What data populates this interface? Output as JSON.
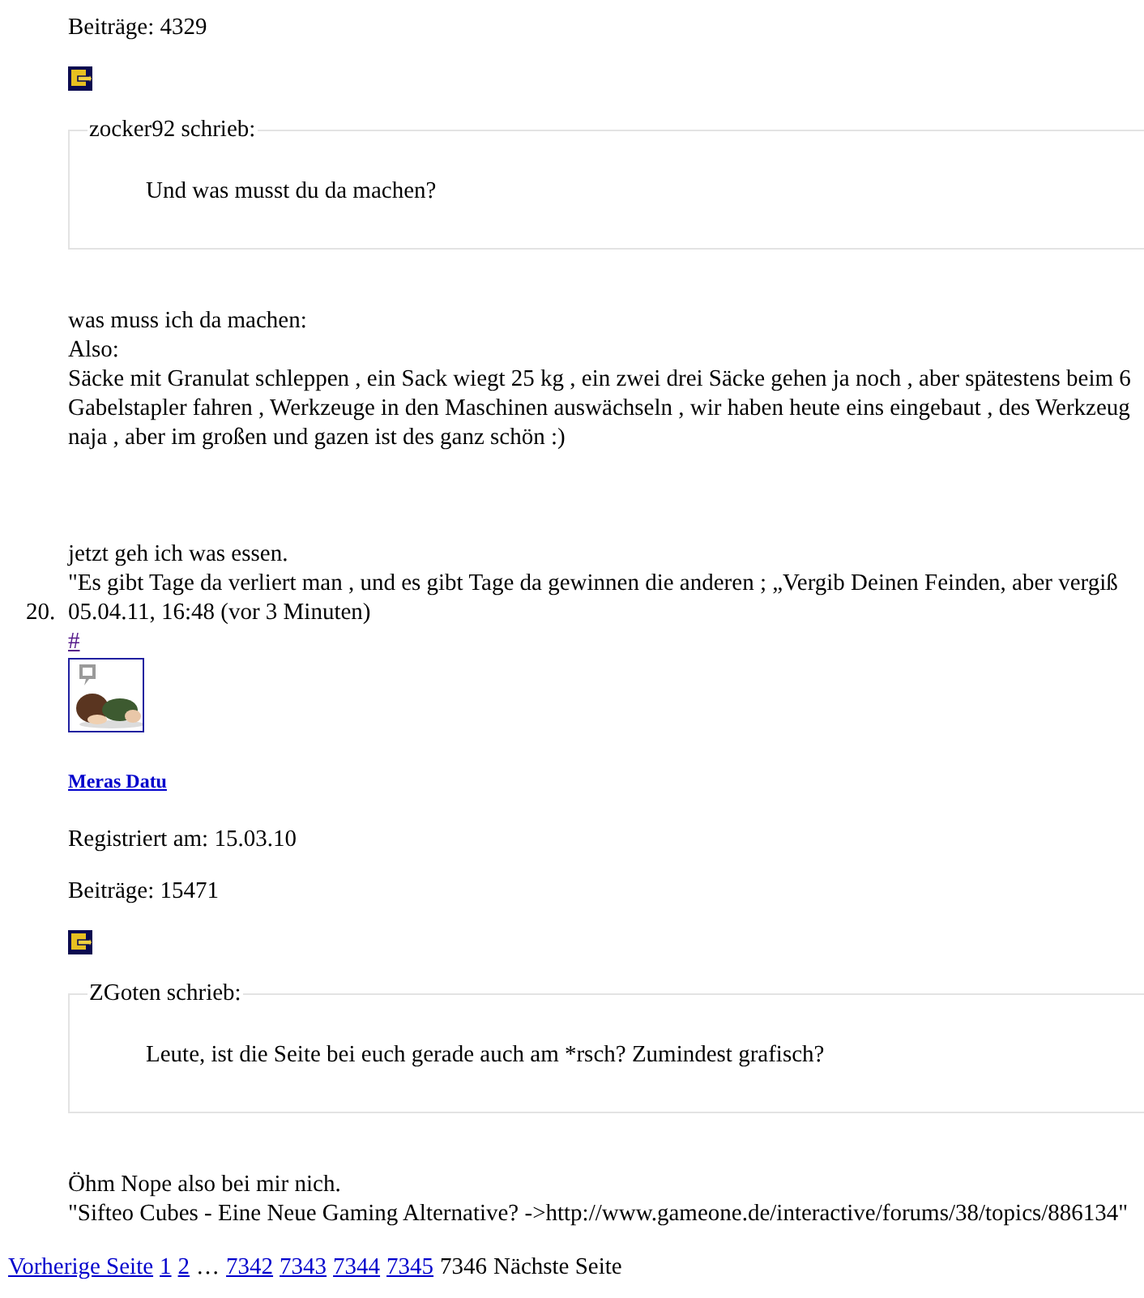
{
  "posts": [
    {
      "posts_count": "Beiträge: 4329",
      "quote": {
        "author": "zocker92 schrieb:",
        "text": "Und was musst du da machen?"
      },
      "body": [
        "was muss ich da machen:",
        "Also:",
        "Säcke mit Granulat schleppen , ein Sack wiegt 25 kg , ein zwei drei Säcke gehen ja noch , aber spätestens beim 6",
        "Gabelstapler fahren , Werkzeuge in den Maschinen auswächseln , wir haben heute eins eingebaut , des Werkzeug",
        "naja , aber im großen und gazen ist des ganz schön :)"
      ],
      "closing": "jetzt geh ich was essen.",
      "signature": "\"Es gibt Tage da verliert man , und es gibt Tage da gewinnen die anderen ; „Vergib Deinen Feinden, aber vergiß"
    },
    {
      "number": "20.",
      "timestamp": "05.04.11, 16:48 (vor 3 Minuten)",
      "anchor": "#",
      "username": "Meras Datu",
      "registered": "Registriert am: 15.03.10",
      "posts_count": "Beiträge: 15471",
      "quote": {
        "author": "ZGoten schrieb:",
        "text": "Leute, ist die Seite bei euch gerade auch am *rsch? Zumindest grafisch?"
      },
      "body": [
        "Öhm Nope also bei mir nich."
      ],
      "signature": "\"Sifteo Cubes - Eine Neue Gaming Alternative? ->http://www.gameone.de/interactive/forums/38/topics/886134\""
    }
  ],
  "pagination": {
    "previous": "Vorherige Seite",
    "pages": [
      {
        "label": "1",
        "kind": "page",
        "selected": false
      },
      {
        "label": "2",
        "kind": "page",
        "selected": false
      },
      {
        "label": "…",
        "kind": "ellipsis"
      },
      {
        "label": "7342",
        "kind": "page",
        "selected": false
      },
      {
        "label": "7343",
        "kind": "page",
        "selected": false
      },
      {
        "label": "7344",
        "kind": "page",
        "selected": false
      },
      {
        "label": "7345",
        "kind": "page",
        "selected": false
      },
      {
        "label": "7346",
        "kind": "page",
        "selected": true
      }
    ],
    "next": {
      "label": "Nächste Seite",
      "disabled": true
    }
  }
}
